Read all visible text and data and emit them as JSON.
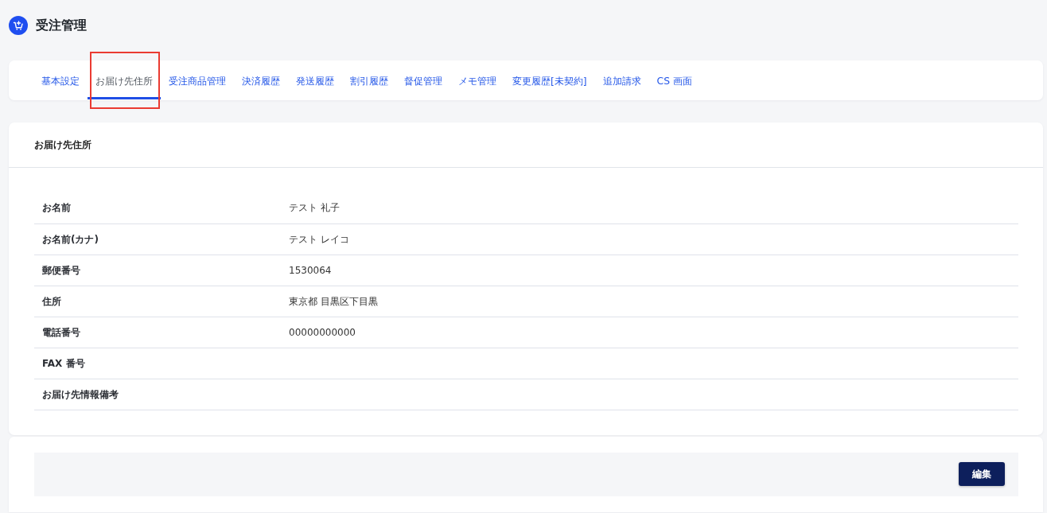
{
  "header": {
    "title": "受注管理"
  },
  "tabs": [
    {
      "label": "基本設定",
      "selected": false,
      "highlighted": false
    },
    {
      "label": "お届け先住所",
      "selected": true,
      "highlighted": true
    },
    {
      "label": "受注商品管理",
      "selected": false,
      "highlighted": false
    },
    {
      "label": "決済履歴",
      "selected": false,
      "highlighted": false
    },
    {
      "label": "発送履歴",
      "selected": false,
      "highlighted": false
    },
    {
      "label": "割引履歴",
      "selected": false,
      "highlighted": false
    },
    {
      "label": "督促管理",
      "selected": false,
      "highlighted": false
    },
    {
      "label": "メモ管理",
      "selected": false,
      "highlighted": false
    },
    {
      "label": "変更履歴[未契約]",
      "selected": false,
      "highlighted": false
    },
    {
      "label": "追加請求",
      "selected": false,
      "highlighted": false
    },
    {
      "label": "CS 画面",
      "selected": false,
      "highlighted": false
    }
  ],
  "panel": {
    "title": "お届け先住所",
    "rows": [
      {
        "label": "お名前",
        "value": "テスト 礼子"
      },
      {
        "label": "お名前(カナ)",
        "value": "テスト レイコ"
      },
      {
        "label": "郵便番号",
        "value": "1530064"
      },
      {
        "label": "住所",
        "value": "東京都 目黒区下目黒"
      },
      {
        "label": "電話番号",
        "value": "00000000000"
      },
      {
        "label": "FAX 番号"
      },
      {
        "label": "お届け先情報備考"
      }
    ]
  },
  "actions": {
    "buttons": [
      {
        "label": "編集"
      }
    ]
  }
}
